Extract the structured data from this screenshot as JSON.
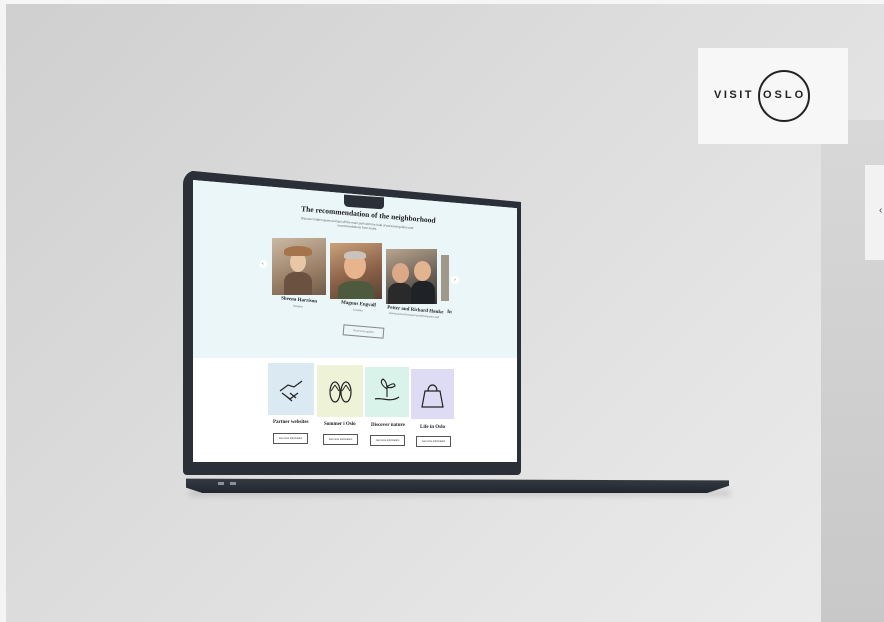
{
  "logo": {
    "visit": "VISIT",
    "oslo": "OSLO"
  },
  "side_tab": {
    "glyph": "‹"
  },
  "hero": {
    "title": "The recommendation of the neighborhood",
    "subtitle": "Discover hidden gems and get off the main path with the help of personal guides and recommendations from locals",
    "prev_icon": "‹",
    "next_icon": "›",
    "more_button": "Read more guides"
  },
  "guides": [
    {
      "name": "Sheena Harrison",
      "role": "Designer"
    },
    {
      "name": "Magnus Engvall",
      "role": "Traveller"
    },
    {
      "name": "Petter and Richard Hauke",
      "role": "Brand partner/Entrepreneurs/Restaurant staff"
    },
    {
      "name": "In",
      "role": ""
    }
  ],
  "tiles": [
    {
      "label": "Partner websites",
      "button": "Get more information",
      "color": "#dbe9f3",
      "icon": "handshake-icon"
    },
    {
      "label": "Sommer i Oslo",
      "button": "Get more information",
      "color": "#eef3d8",
      "icon": "flip-flops-icon"
    },
    {
      "label": "Discover nature",
      "button": "Get more information",
      "color": "#d9f3ea",
      "icon": "plant-hand-icon"
    },
    {
      "label": "Life in Oslo",
      "button": "Get more information",
      "color": "#dedcf5",
      "icon": "shopping-bag-icon"
    }
  ]
}
